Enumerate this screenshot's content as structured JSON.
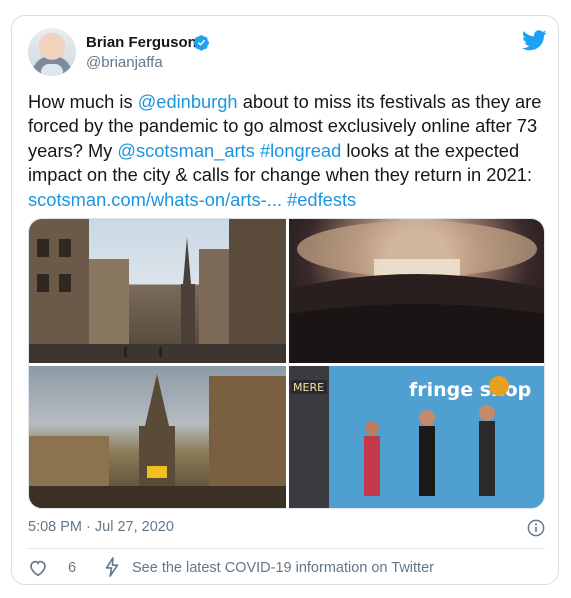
{
  "tweet": {
    "author_name": "Brian Ferguson",
    "author_handle": "@brianjaffa",
    "verified": true,
    "text_segments": [
      {
        "text": "How much is ",
        "link": false
      },
      {
        "text": "@edinburgh",
        "link": true
      },
      {
        "text": " about to miss its festivals as they are forced by the pandemic to go almost exclusively online after 73 years? My ",
        "link": false
      },
      {
        "text": "@scotsman_arts",
        "link": true
      },
      {
        "text": " ",
        "link": false
      },
      {
        "text": "#longread",
        "link": true
      },
      {
        "text": " looks at the expected impact on the city & calls for change when they return in 2021: ",
        "link": false
      },
      {
        "text": "scotsman.com/whats-on/arts-...",
        "link": true
      },
      {
        "text": " ",
        "link": false
      },
      {
        "text": "#edfests",
        "link": true
      }
    ],
    "timestamp": "5:08 PM · Jul 27, 2020",
    "like_count": "6",
    "covid_link": "See the latest COVID-19 information on Twitter",
    "media": [
      {
        "desc_icon": "photo-edinburgh-royal-mile"
      },
      {
        "desc_icon": "photo-concert-hall-audience"
      },
      {
        "desc_icon": "photo-tron-kirk-crowd"
      },
      {
        "desc_icon": "photo-fringe-shop-street"
      }
    ]
  },
  "colors": {
    "link": "#1b95e0",
    "secondary_text": "#657786",
    "twitter_blue": "#1da1f2",
    "heart": "#657786",
    "border": "#d6dde3"
  },
  "images_text": {
    "shop_sign": "fringe shop",
    "shop_sign_left": "MERE"
  }
}
